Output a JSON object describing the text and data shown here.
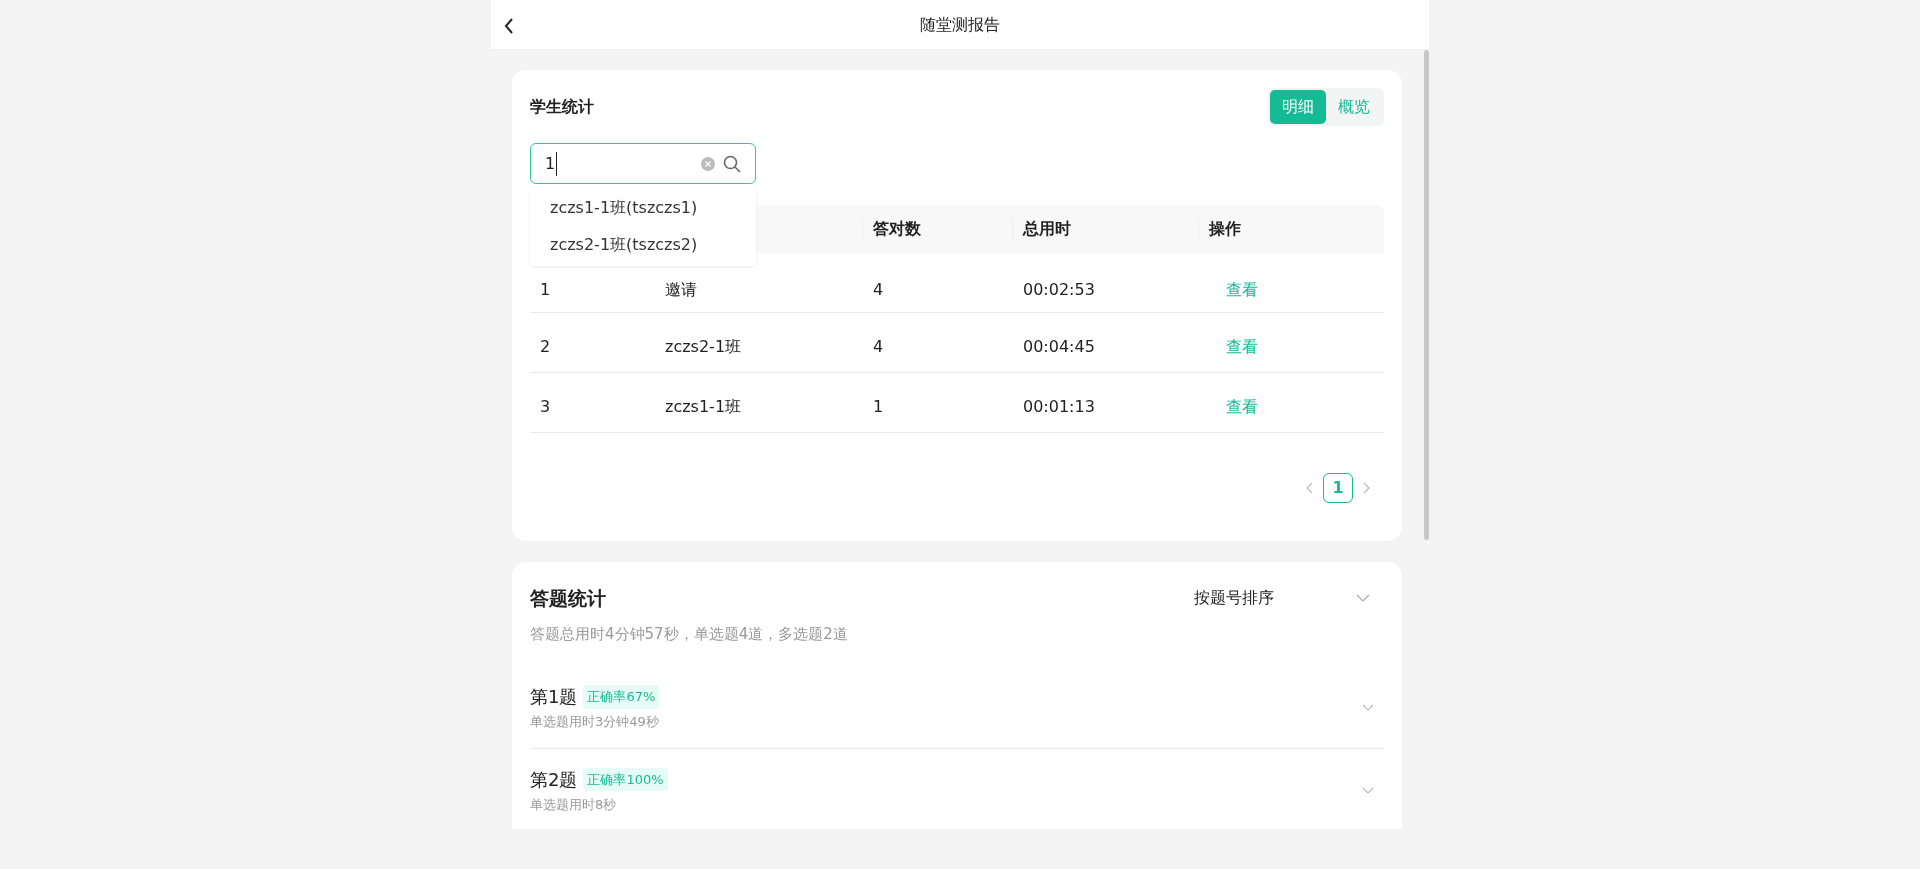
{
  "header": {
    "title": "随堂测报告"
  },
  "student_stats": {
    "title": "学生统计",
    "view_tabs": [
      {
        "label": "明细",
        "selected": true
      },
      {
        "label": "概览",
        "selected": false
      }
    ],
    "search": {
      "value": "1",
      "suggestions": [
        "zczs1-1班(tszczs1)",
        "zczs2-1班(tszczs2)"
      ]
    },
    "table": {
      "columns": [
        "答对数",
        "总用时",
        "操作"
      ],
      "rows": [
        {
          "no": "1",
          "name": "邀请",
          "correct": "4",
          "time": "00:02:53",
          "action": "查看"
        },
        {
          "no": "2",
          "name": "zczs2-1班",
          "correct": "4",
          "time": "00:04:45",
          "action": "查看"
        },
        {
          "no": "3",
          "name": "zczs1-1班",
          "correct": "1",
          "time": "00:01:13",
          "action": "查看"
        }
      ]
    },
    "pagination": {
      "pages": [
        {
          "label": "1",
          "selected": true
        }
      ]
    }
  },
  "answer_stats": {
    "title": "答题统计",
    "summary": "答题总用时4分钟57秒，单选题4道，多选题2道",
    "sort": {
      "value": "按题号排序"
    },
    "questions": [
      {
        "title": "第1题",
        "accuracy": "正确率67%",
        "detail": "单选题用时3分钟49秒"
      },
      {
        "title": "第2题",
        "accuracy": "正确率100%",
        "detail": "单选题用时8秒"
      }
    ]
  }
}
